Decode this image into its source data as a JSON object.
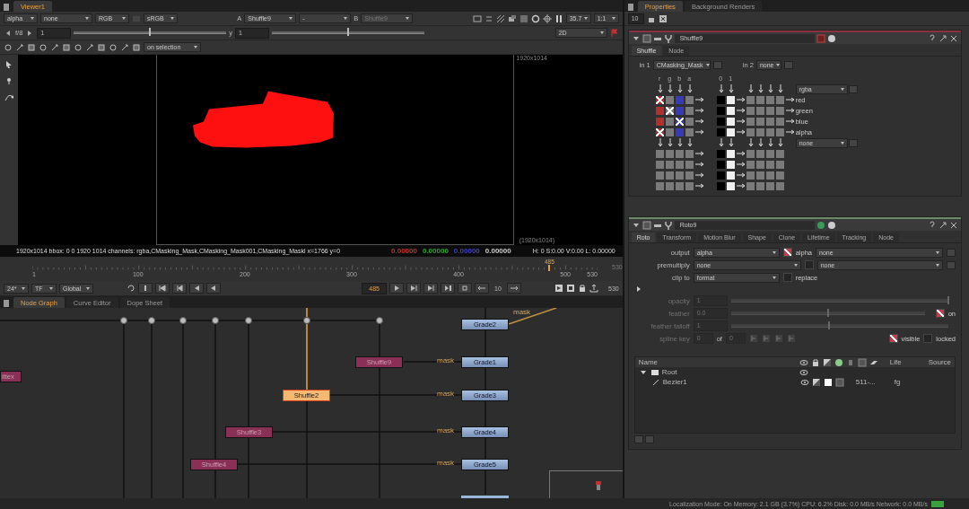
{
  "viewer": {
    "tab": "Viewer1",
    "channel_menus": [
      "alpha",
      "none",
      "RGB",
      "sRGB"
    ],
    "input_a": {
      "label": "A",
      "value": "Shuffle9"
    },
    "ab_op": "-",
    "input_b": {
      "label": "B",
      "value": "Shuffle9",
      "disabled": true
    },
    "zoom": "35.7",
    "ratio": "1:1",
    "gain_label": "f/8",
    "gain_value": "1",
    "gain_slider": {
      "level": 0.5
    },
    "gamma_label": "y",
    "gamma_value": "1",
    "gamma_slider": {
      "level": 0.5
    },
    "mode": "2D",
    "roi_mode": "on selection",
    "format_top": "1920x1014",
    "format_bottom": "(1920x1014)",
    "info": {
      "text": "1920x1014  bbox: 0 0 1920 1014 channels: rgba,CMasking_Mask,CMasking_Mask001,CMasking_Maskl  x=1766 y=0",
      "pixel": [
        {
          "value": "0.00000",
          "color": "#c03030"
        },
        {
          "value": "0.00000",
          "color": "#30a030"
        },
        {
          "value": "0.00000",
          "color": "#4040c0"
        },
        {
          "value": "0.00000",
          "color": "#d0d0d0"
        }
      ],
      "hsvl": "H: 0 S:0.00 V:0.00  L: 0.00000"
    }
  },
  "timeline": {
    "ticks": [
      "1",
      "100",
      "200",
      "300",
      "400",
      "500",
      "530"
    ],
    "current": "485",
    "level": 0.915,
    "end": "530"
  },
  "transport": {
    "fps": "24*",
    "tf": "TF",
    "scope": "Global",
    "frame": "485",
    "step": "10",
    "end": "530"
  },
  "node_graph": {
    "tabs": [
      {
        "label": "Node Graph",
        "selected": true
      },
      {
        "label": "Curve Editor",
        "selected": false
      },
      {
        "label": "Dope Sheet",
        "selected": false
      }
    ],
    "nodes": [
      {
        "label": "Grade2",
        "kind": "grade",
        "selected": false
      },
      {
        "label": "Shuffle9",
        "kind": "shuffle",
        "selected": false
      },
      {
        "label": "Grade1",
        "kind": "grade",
        "selected": false
      },
      {
        "label": "Shuffle2",
        "kind": "shuffle",
        "selected": true
      },
      {
        "label": "Grade3",
        "kind": "grade",
        "selected": false
      },
      {
        "label": "Shuffle3",
        "kind": "shuffle",
        "selected": false
      },
      {
        "label": "Grade4",
        "kind": "grade",
        "selected": false
      },
      {
        "label": "Shuffle4",
        "kind": "shuffle",
        "selected": false
      },
      {
        "label": "Grade5",
        "kind": "grade",
        "selected": false
      },
      {
        "label": "ittex",
        "kind": "shuffle",
        "selected": false
      }
    ],
    "mask_labels": [
      "mask",
      "mask",
      "mask",
      "mask",
      "mask"
    ]
  },
  "properties": {
    "tabs": [
      {
        "label": "Properties",
        "selected": true
      },
      {
        "label": "Background Renders",
        "selected": false
      }
    ],
    "max_panels": "10",
    "shuffle_panel": {
      "name": "Shuffle9",
      "tabs": [
        {
          "label": "Shuffle",
          "selected": true
        },
        {
          "label": "Node",
          "selected": false
        }
      ],
      "in1_label": "in 1",
      "in1": "CMasking_Mask",
      "in2_label": "in 2",
      "in2": "none",
      "in1_channels": [
        "r",
        "g",
        "b",
        "a"
      ],
      "in2_channels": [
        "0",
        "1"
      ],
      "out1": "rgba",
      "out2": "none",
      "out_rows": [
        {
          "label": "red",
          "checked": [
            true,
            false,
            false,
            false
          ]
        },
        {
          "label": "green",
          "checked": [
            false,
            true,
            false,
            false
          ]
        },
        {
          "label": "blue",
          "checked": [
            false,
            false,
            true,
            false
          ]
        },
        {
          "label": "alpha",
          "checked": [
            true,
            false,
            false,
            false
          ]
        }
      ],
      "out2_rows": [
        {
          "checked": [
            false,
            false,
            false,
            false
          ]
        },
        {
          "checked": [
            false,
            false,
            false,
            false
          ]
        },
        {
          "checked": [
            false,
            false,
            false,
            false
          ]
        },
        {
          "checked": [
            false,
            false,
            false,
            false
          ]
        }
      ]
    },
    "roto_panel": {
      "name": "Roto9",
      "tabs": [
        {
          "label": "Roto",
          "selected": true
        },
        {
          "label": "Transform",
          "selected": false
        },
        {
          "label": "Motion Blur",
          "selected": false
        },
        {
          "label": "Shape",
          "selected": false
        },
        {
          "label": "Clone",
          "selected": false
        },
        {
          "label": "Lifetime",
          "selected": false
        },
        {
          "label": "Tracking",
          "selected": false
        },
        {
          "label": "Node",
          "selected": false
        }
      ],
      "fields": [
        {
          "label": "output",
          "value": "alpha",
          "check_label": "alpha",
          "checked": true,
          "value2": "none"
        },
        {
          "label": "premultiply",
          "value": "none",
          "checked": false,
          "value2": "none"
        },
        {
          "label": "clip to",
          "value": "format",
          "check_label": "replace",
          "checked": false
        }
      ],
      "sliders": [
        {
          "label": "opacity",
          "value": "1",
          "level": 1,
          "disabled": true
        },
        {
          "label": "feather",
          "value": "0.0",
          "level": 0.5,
          "disabled": true,
          "check_label": "on",
          "checked": true
        },
        {
          "label": "feather falloff",
          "value": "1",
          "level": 0.45,
          "disabled": true
        }
      ],
      "spline_key": {
        "label": "spline key",
        "value": "0",
        "of": "of",
        "total": "0",
        "disabled": true
      },
      "visible": {
        "label": "visible",
        "checked": true
      },
      "locked": {
        "label": "locked",
        "checked": false
      },
      "tree": {
        "columns": [
          "Name",
          "Life",
          "Source"
        ],
        "items": [
          {
            "label": "Root",
            "expanded": true,
            "children": [
              {
                "label": "Bezier1",
                "life": "511-...",
                "source": "fg"
              }
            ]
          }
        ]
      }
    }
  },
  "status_bar": "Localization Mode: On Memory: 2.1 GB (3.7%) CPU: 6.2% Disk: 0.0 MB/s Network: 0.0 MB/s"
}
